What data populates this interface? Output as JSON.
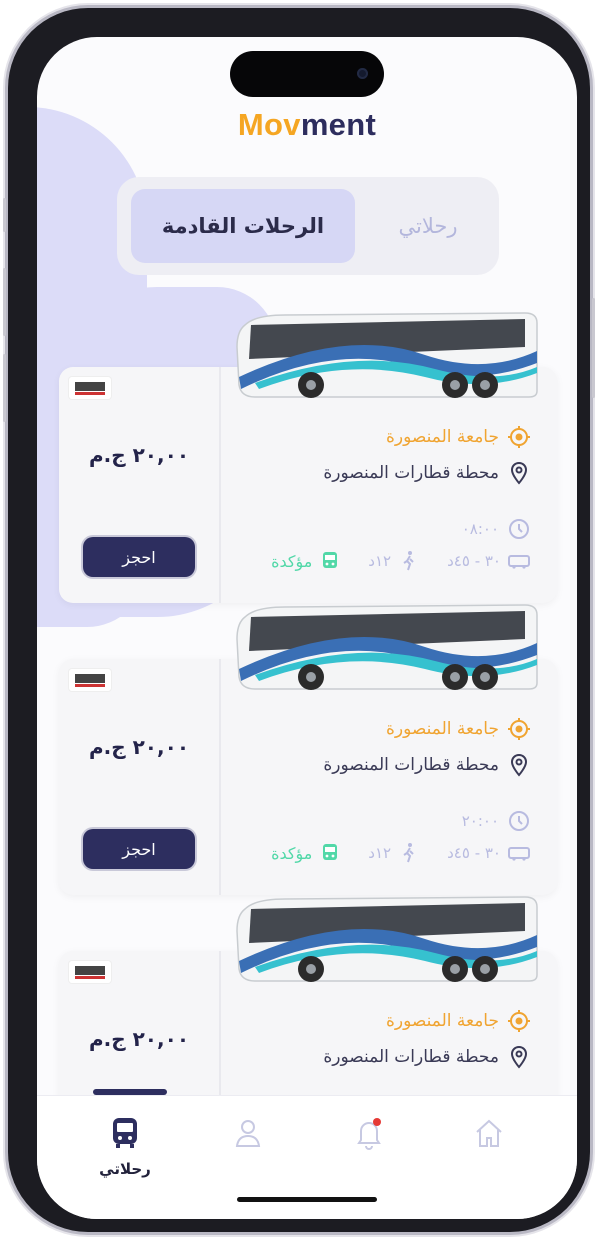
{
  "app": {
    "logo_part1": "Mov",
    "logo_part2": "ment"
  },
  "tabs": {
    "upcoming": "الرحلات القادمة",
    "my_trips": "رحلاتي"
  },
  "trips": [
    {
      "from": "جامعة المنصورة",
      "to": "محطة قطارات المنصورة",
      "price": "٢٠,٠٠ ج.م",
      "time": "٠٨:٠٠",
      "duration": "٣٠ - ٤٥د",
      "walk": "١٢د",
      "status": "مؤكدة",
      "book_label": "احجز"
    },
    {
      "from": "جامعة المنصورة",
      "to": "محطة قطارات المنصورة",
      "price": "٢٠,٠٠ ج.م",
      "time": "٢٠:٠٠",
      "duration": "٣٠ - ٤٥د",
      "walk": "١٢د",
      "status": "مؤكدة",
      "book_label": "احجز"
    },
    {
      "from": "جامعة المنصورة",
      "to": "محطة قطارات المنصورة",
      "price": "٢٠,٠٠ ج.م"
    }
  ],
  "nav": {
    "my_trips": "رحلاتي"
  },
  "colors": {
    "primary": "#2d2e5f",
    "accent": "#f5a623",
    "confirmed": "#52d8a8",
    "muted": "#b8bbe0"
  },
  "icons": [
    "target-icon",
    "location-pin-icon",
    "clock-icon",
    "bus-icon",
    "walk-icon",
    "home-icon",
    "bell-icon",
    "user-icon"
  ]
}
